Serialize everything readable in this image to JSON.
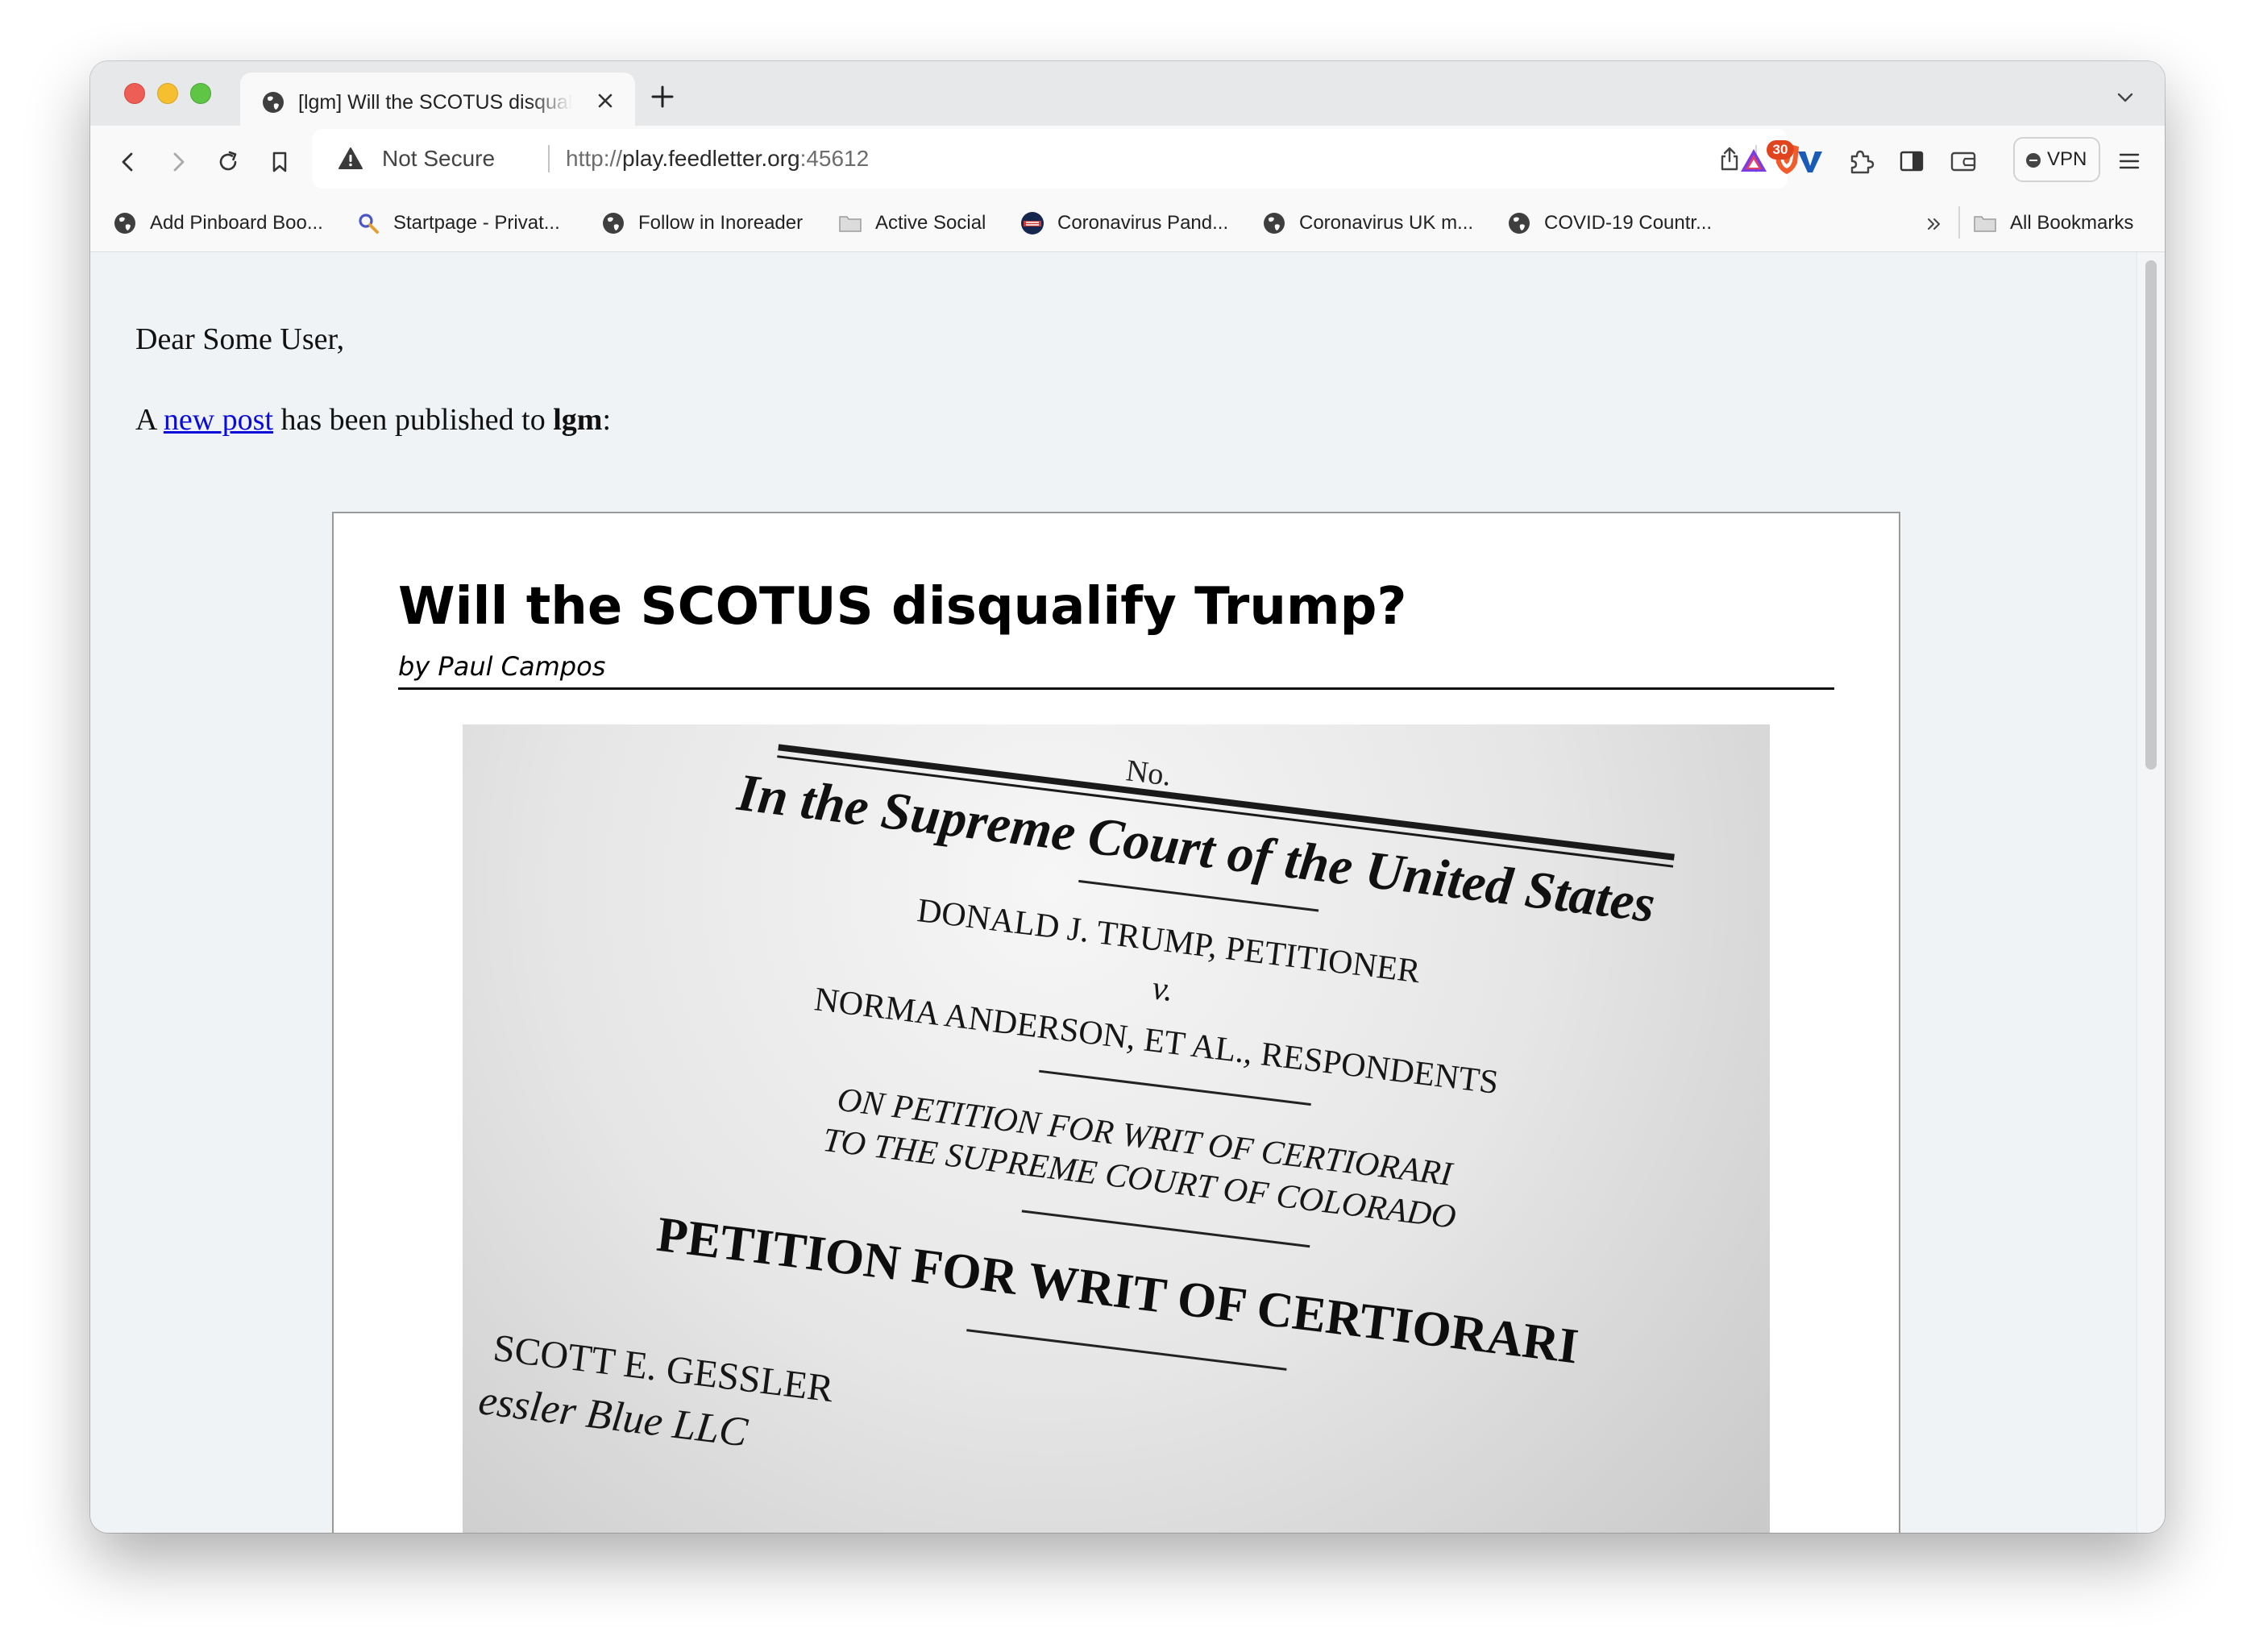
{
  "tab": {
    "title": "[lgm] Will the SCOTUS disqualify Trump?"
  },
  "address_bar": {
    "security_label": "Not Secure",
    "url_prefix": "http://",
    "url_host": "play.feedletter.org",
    "url_port": ":45612"
  },
  "extensions": {
    "rewards_badge": "30",
    "vpn_label": "VPN"
  },
  "bookmarks": [
    {
      "label": "Add Pinboard Boo...",
      "icon": "globe-icon"
    },
    {
      "label": "Startpage - Privat...",
      "icon": "magnifier-icon"
    },
    {
      "label": "Follow in Inoreader",
      "icon": "globe-icon"
    },
    {
      "label": "Active Social",
      "icon": "folder-icon"
    },
    {
      "label": "Coronavirus Pand...",
      "icon": "data-icon"
    },
    {
      "label": "Coronavirus UK m...",
      "icon": "globe-icon"
    },
    {
      "label": "COVID-19 Countr...",
      "icon": "globe-icon"
    }
  ],
  "bookmarks_all": {
    "label": "All Bookmarks",
    "icon": "folder-icon"
  },
  "email": {
    "greeting": "Dear Some User,",
    "intro_before": "A ",
    "intro_link": "new post",
    "intro_middle": " has been published to ",
    "feed_name": "lgm",
    "intro_after": ":"
  },
  "post": {
    "title": "Will the SCOTUS disqualify Trump?",
    "byline": "by Paul Campos"
  },
  "figure": {
    "no_label": "No.",
    "court_heading": "In the Supreme Court of the United States",
    "petitioner": "DONALD J. TRUMP, PETITIONER",
    "versus": "v.",
    "respondents": "NORMA ANDERSON, ET AL., RESPONDENTS",
    "petition_line1": "ON PETITION FOR WRIT OF CERTIORARI",
    "petition_line2": "TO THE SUPREME COURT OF COLORADO",
    "doc_title": "PETITION FOR WRIT OF CERTIORARI",
    "counsel_name": "SCOTT E. GESSLER",
    "counsel_firm": "essler Blue LLC"
  }
}
